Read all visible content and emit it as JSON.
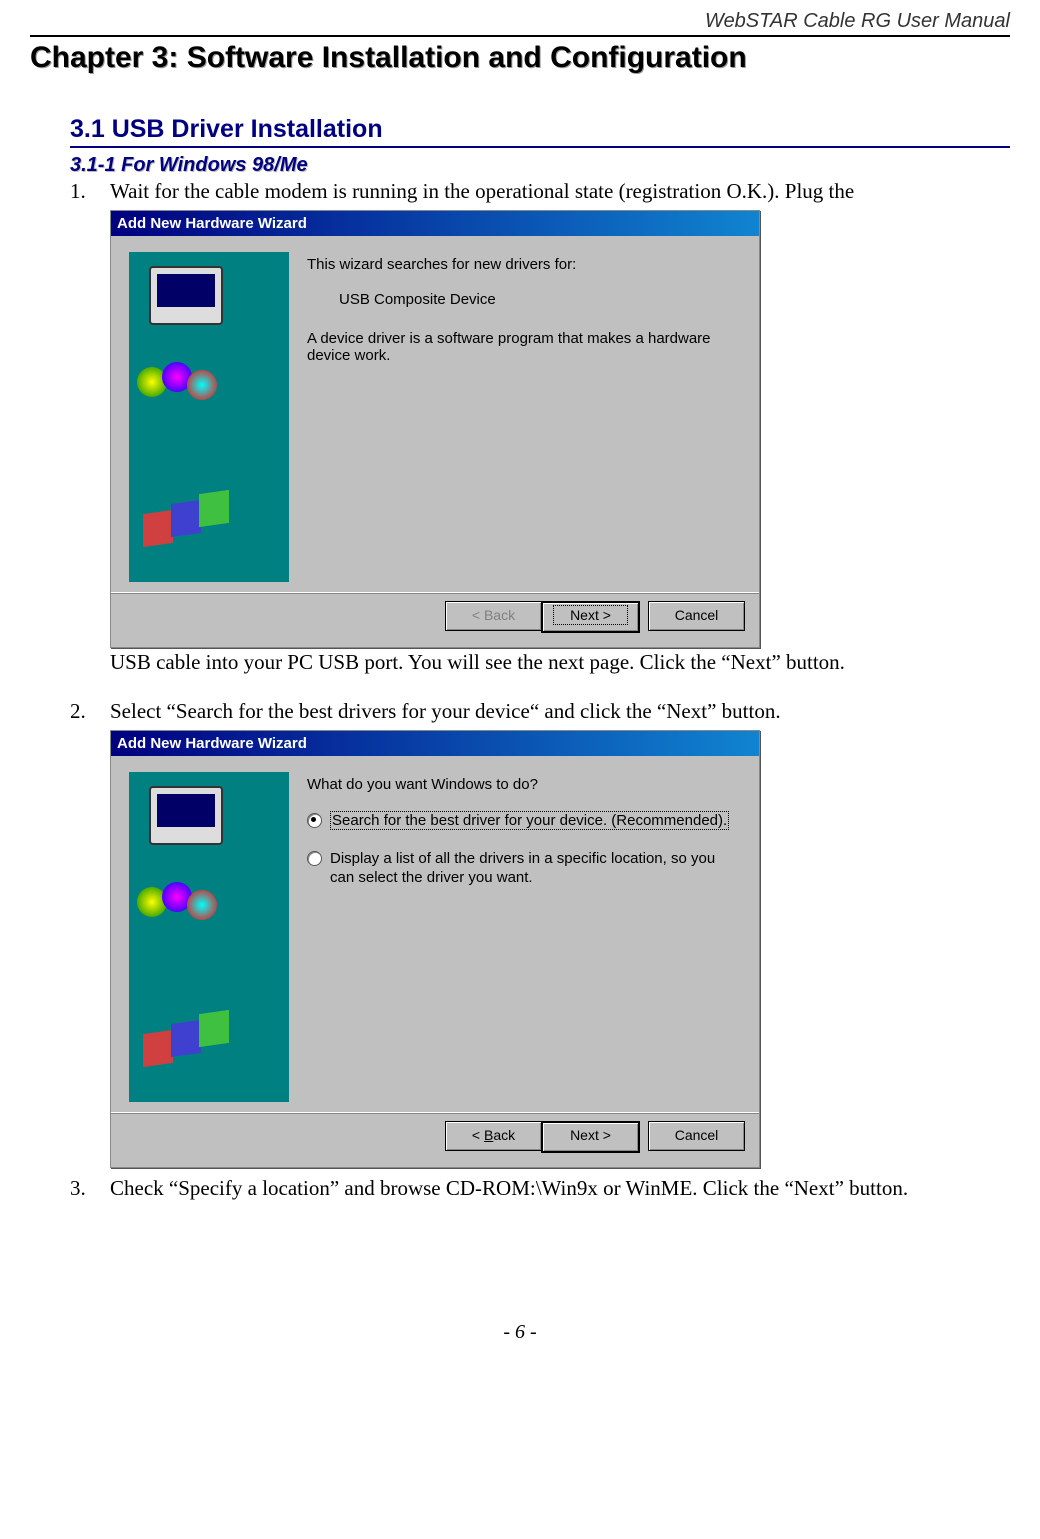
{
  "header": {
    "product": "WebSTAR Cable RG",
    "doc_type": "User Manual"
  },
  "chapter_title": "Chapter 3: Software Installation and Configuration",
  "section_title": "3.1 USB Driver Installation",
  "subsection_title": "3.1-1 For Windows 98/Me",
  "steps": {
    "s1_num": "1.",
    "s1_text_a": "Wait for the cable modem is running in the operational state (registration O.K.). Plug the",
    "s1_text_b": "USB cable into your PC USB port. You will see the next page. Click the “Next” button.",
    "s2_num": "2.",
    "s2_text": "Select “Search for the best drivers for your device“ and click the “Next” button.",
    "s3_num": "3.",
    "s3_text": "Check “Specify a location” and browse CD-ROM:\\Win9x or WinME. Click the “Next” button."
  },
  "wizard1": {
    "title": "Add New Hardware Wizard",
    "line1": "This wizard searches for new drivers for:",
    "device": "USB Composite Device",
    "line2": "A device driver is a software program that makes a hardware device work.",
    "back": "< Back",
    "next": "Next >",
    "cancel": "Cancel"
  },
  "wizard2": {
    "title": "Add New Hardware Wizard",
    "prompt": "What do you want Windows to do?",
    "opt1": "Search for the best driver for your device. (Recommended).",
    "opt2": "Display a list of all the drivers in a specific location, so you can select the driver you want.",
    "back_prefix": "< ",
    "back_u": "B",
    "back_suffix": "ack",
    "next": "Next >",
    "cancel": "Cancel"
  },
  "footer": "- 6 -"
}
